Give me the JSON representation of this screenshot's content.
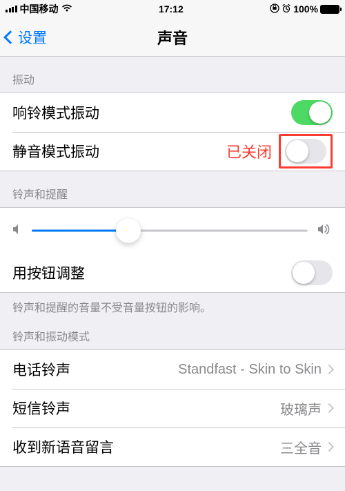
{
  "status": {
    "carrier": "中国移动",
    "time": "17:12",
    "battery": "100%"
  },
  "nav": {
    "back": "设置",
    "title": "声音"
  },
  "sections": {
    "vibration": {
      "header": "振动",
      "ring_vibrate": "响铃模式振动",
      "silent_vibrate": "静音模式振动",
      "off_text": "已关闭"
    },
    "ringer": {
      "header": "铃声和提醒",
      "slider_pct": 35,
      "button_change": "用按钮调整",
      "footer": "铃声和提醒的音量不受音量按钮的影响。"
    },
    "patterns": {
      "header": "铃声和振动模式",
      "ringtone_label": "电话铃声",
      "ringtone_value": "Standfast - Skin to Skin",
      "text_label": "短信铃声",
      "text_value": "玻璃声",
      "voicemail_label": "收到新语音留言",
      "voicemail_value": "三全音"
    }
  },
  "toggles": {
    "ring_vibrate": true,
    "silent_vibrate": false,
    "button_change": false
  }
}
